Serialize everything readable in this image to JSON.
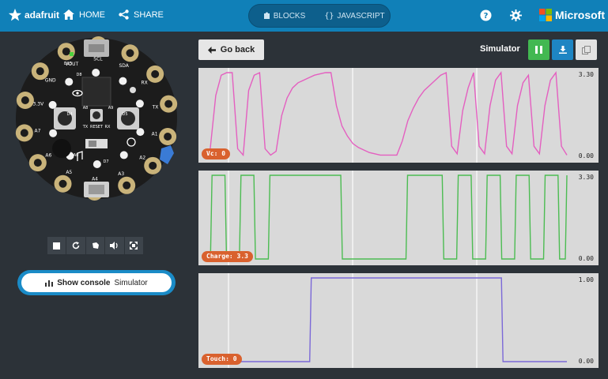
{
  "topbar": {
    "brand": "adafruit",
    "home_label": "HOME",
    "share_label": "SHARE",
    "blocks_label": "BLOCKS",
    "javascript_label": "JAVASCRIPT",
    "microsoft_label": "Microsoft",
    "icons": [
      "star-logo-icon",
      "home-icon",
      "share-icon",
      "puzzle-icon",
      "braces-icon",
      "help-icon",
      "gear-icon",
      "microsoft-logo-icon"
    ]
  },
  "board": {
    "pin_labels": [
      "A1",
      "A2",
      "A3",
      "A4",
      "A5",
      "A6",
      "A7",
      "3.3V",
      "GND",
      "VOUT",
      "SCL",
      "SDA",
      "RX",
      "TX"
    ],
    "board_labels": [
      "D13",
      "D8",
      "D4",
      "D5",
      "A8",
      "A9",
      "RESET",
      "TX",
      "RX",
      "A0",
      "D7"
    ]
  },
  "controls": [
    "stop-icon",
    "restart-icon",
    "debug-icon",
    "mute-icon",
    "fullscreen-icon"
  ],
  "console_button": {
    "bold": "Show console",
    "rest": "Simulator"
  },
  "right": {
    "back_label": "Go back",
    "simulator_label": "Simulator",
    "accent_colors": {
      "pause": "#42b851",
      "download": "#1e85c3"
    }
  },
  "charts": [
    {
      "badge": "Vc: 0",
      "ymax_label": "3.30",
      "ymin_label": "0.00",
      "color": "#e45fc0"
    },
    {
      "badge": "Charge: 3.3",
      "ymax_label": "3.30",
      "ymin_label": "0.00",
      "color": "#4cbc52"
    },
    {
      "badge": "Touch: 0",
      "ymax_label": "1.00",
      "ymin_label": "0.00",
      "color": "#7b68d8"
    }
  ],
  "chart_data": [
    {
      "type": "line",
      "series": [
        {
          "values": [
            0,
            0.3,
            2.4,
            3.2,
            3.3,
            3.3,
            0.3,
            0.05,
            2.6,
            3.2,
            3.3,
            0.3,
            0.05,
            0.2,
            1.6,
            2.3,
            2.7,
            2.9,
            3.0,
            3.1,
            3.2,
            3.25,
            3.3,
            3.3,
            2.0,
            1.2,
            0.8,
            0.5,
            0.35,
            0.25,
            0.15,
            0.1,
            0.05,
            0.05,
            0.05,
            0.05,
            0.6,
            1.4,
            1.9,
            2.3,
            2.6,
            2.8,
            3.0,
            3.2,
            3.3,
            0.4,
            0.1,
            1.8,
            2.7,
            3.3,
            0.4,
            0.1,
            2.0,
            3.0,
            3.3,
            0.4,
            0.1,
            2.0,
            2.9,
            3.2,
            0.4,
            0.1,
            2.0,
            3.0,
            3.3,
            0.4,
            0.05
          ]
        }
      ],
      "ylim": [
        0,
        3.3
      ]
    },
    {
      "type": "line",
      "series": [
        {
          "values": [
            0,
            3.3,
            3.3,
            0,
            0,
            3.3,
            3.3,
            0,
            0,
            3.3,
            3.3,
            3.3,
            3.3,
            3.3,
            3.3,
            3.3,
            3.3,
            3.3,
            3.3,
            0,
            0,
            0,
            0,
            0,
            0,
            0,
            0,
            0,
            3.3,
            3.3,
            3.3,
            3.3,
            3.3,
            0,
            0,
            3.3,
            3.3,
            0,
            0,
            3.3,
            3.3,
            0,
            0,
            3.3,
            3.3,
            0,
            0,
            3.3,
            3.3,
            0,
            3.3
          ]
        }
      ],
      "ylim": [
        0,
        3.3
      ]
    },
    {
      "type": "line",
      "series": [
        {
          "values": [
            0,
            0,
            0,
            0,
            0,
            1,
            1,
            1,
            1,
            1,
            1,
            1,
            1,
            1,
            0,
            0,
            0,
            0
          ]
        }
      ],
      "ylim": [
        0,
        1
      ]
    }
  ]
}
